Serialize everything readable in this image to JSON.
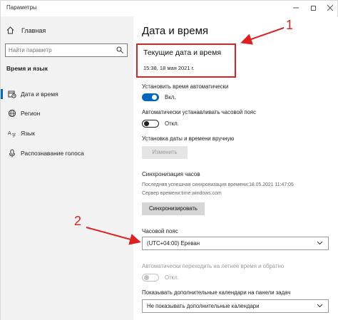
{
  "window": {
    "title": "Параметры"
  },
  "sidebar": {
    "home": "Главная",
    "search_placeholder": "Найти параметр",
    "section": "Время и язык",
    "items": [
      {
        "label": "Дата и время",
        "icon": "calendar-clock-icon",
        "active": true
      },
      {
        "label": "Регион",
        "icon": "globe-icon",
        "active": false
      },
      {
        "label": "Язык",
        "icon": "language-icon",
        "active": false
      },
      {
        "label": "Распознавание голоса",
        "icon": "microphone-icon",
        "active": false
      }
    ]
  },
  "main": {
    "title": "Дата и время",
    "current_label": "Текущие дата и время",
    "current_value": "15:38, 18 мая 2021 г.",
    "auto_time_label": "Установить время автоматически",
    "auto_time_state": "Вкл.",
    "auto_tz_label": "Автоматически устанавливать часовой пояс",
    "auto_tz_state": "Откл.",
    "manual_label": "Установка даты и времени вручную",
    "change_button": "Изменить",
    "sync_title": "Синхронизация часов",
    "sync_info1": "Последняя успешная синхронизация времени:18.05.2021 11:47:05",
    "sync_info2": "Сервер времени:time.windows.com",
    "sync_button": "Синхронизировать",
    "tz_label": "Часовой пояс",
    "tz_value": "(UTC+04:00) Ереван",
    "dst_label": "Автоматически переходить на летнее время и обратно",
    "dst_state": "Откл.",
    "cal_label": "Показывать дополнительные календари на панели задач",
    "cal_value": "Не показывать дополнительные календари"
  },
  "annotations": {
    "callout1": "1",
    "callout2": "2"
  },
  "colors": {
    "accent": "#0067c0",
    "annotation": "#e02020"
  }
}
